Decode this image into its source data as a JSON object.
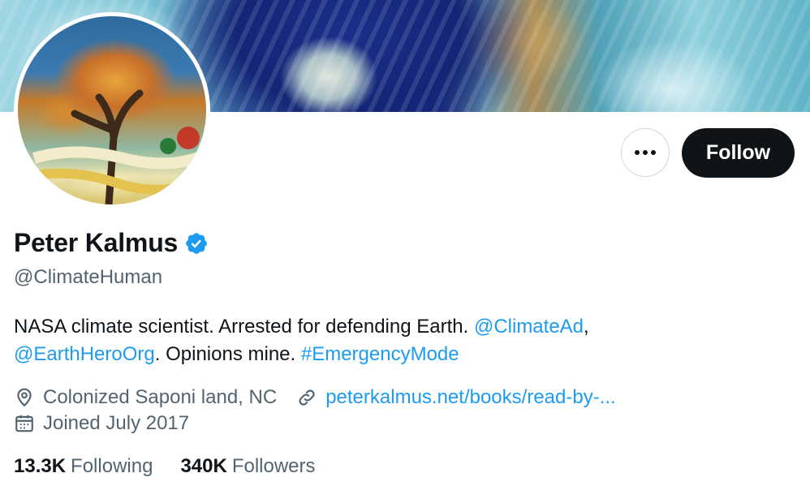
{
  "profile": {
    "name": "Peter Kalmus",
    "handle": "@ClimateHuman",
    "verified": true,
    "bio": {
      "text1": "NASA climate scientist. Arrested for defending Earth. ",
      "mention1": "@ClimateAd",
      "text2": ",",
      "mention2": "@EarthHeroOrg",
      "text3": ". Opinions mine. ",
      "hashtag": "#EmergencyMode"
    },
    "location": "Colonized Saponi land, NC",
    "website": "peterkalmus.net/books/read-by-...",
    "joined": "Joined July 2017",
    "following_count": "13.3K",
    "following_label": "Following",
    "followers_count": "340K",
    "followers_label": "Followers"
  },
  "actions": {
    "more_icon": "more-horizontal-icon",
    "follow_label": "Follow"
  },
  "colors": {
    "accent": "#1d9bf0",
    "text_primary": "#0f1419",
    "text_secondary": "#536471",
    "button_dark": "#0f1419"
  }
}
